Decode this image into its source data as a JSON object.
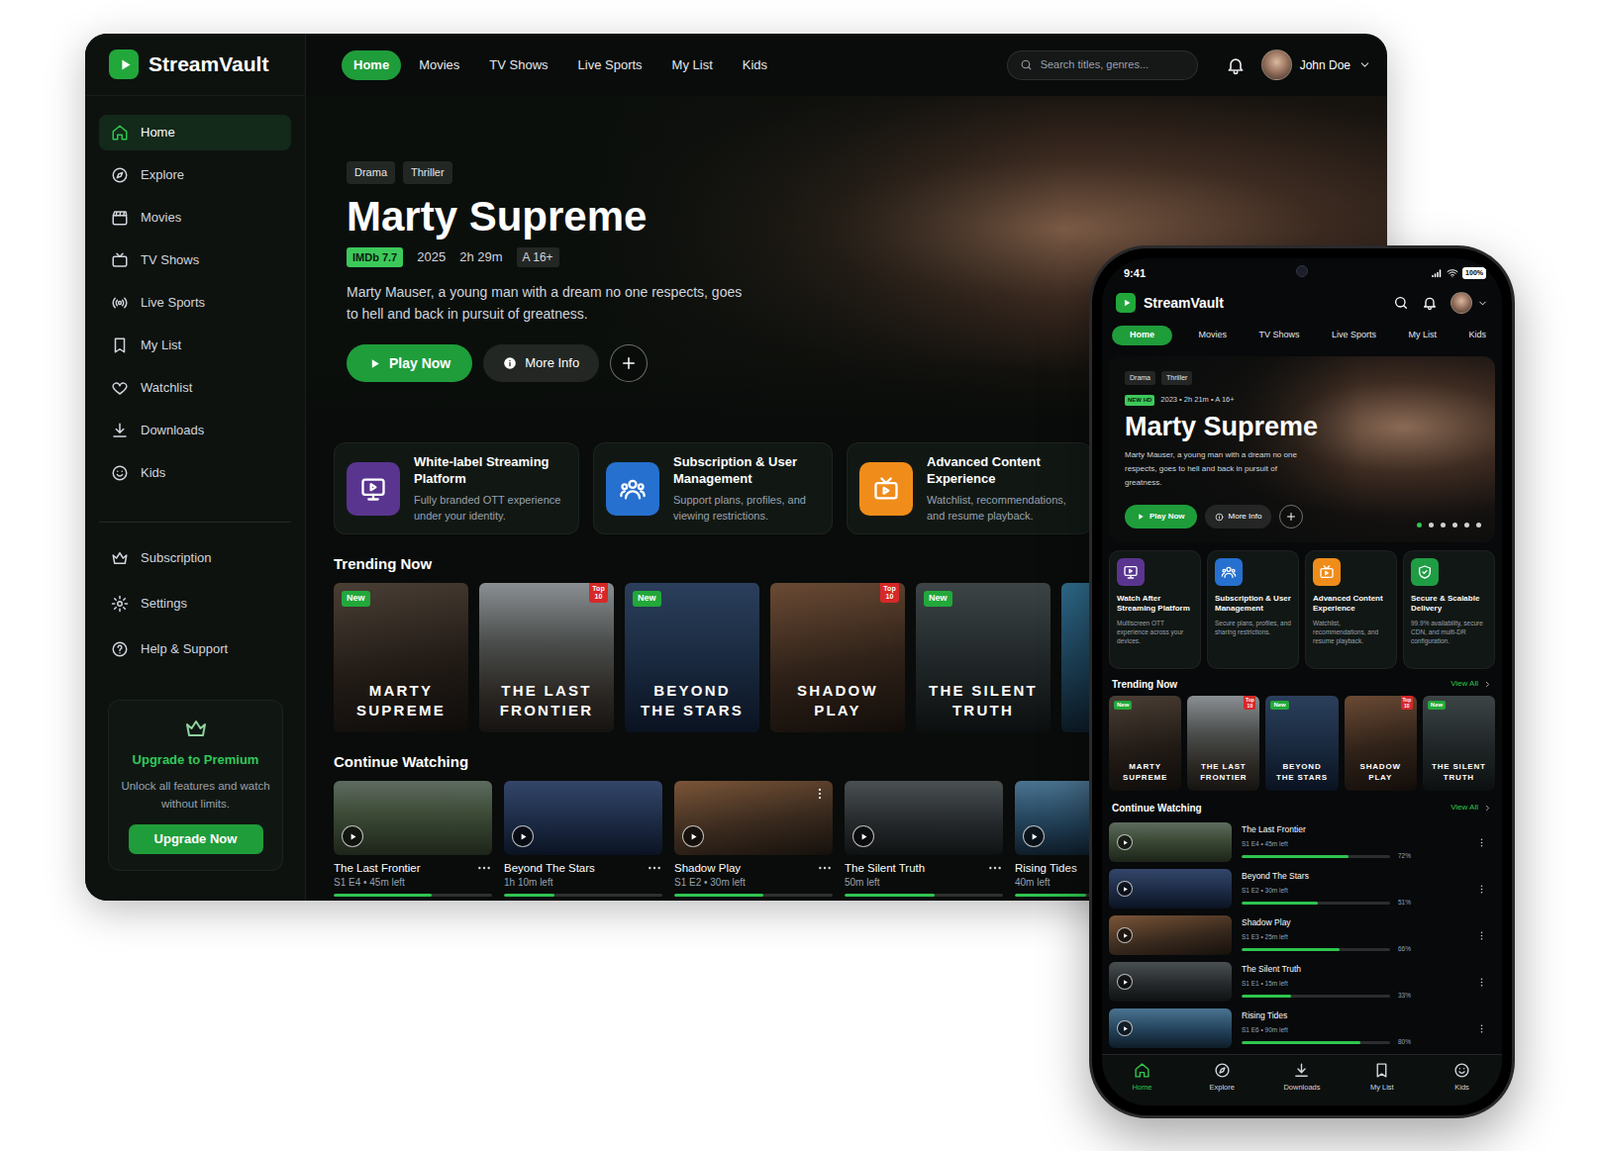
{
  "app": {
    "name": "StreamVault"
  },
  "desktop": {
    "nav": [
      {
        "label": "Home",
        "selected": true
      },
      {
        "label": "Movies",
        "selected": false
      },
      {
        "label": "TV Shows",
        "selected": false
      },
      {
        "label": "Live Sports",
        "selected": false
      },
      {
        "label": "My List",
        "selected": false
      },
      {
        "label": "Kids",
        "selected": false
      }
    ],
    "search": {
      "placeholder": "Search titles, genres..."
    },
    "user": {
      "name": "John Doe"
    },
    "sidebar": {
      "main": [
        {
          "label": "Home",
          "selected": true
        },
        {
          "label": "Explore",
          "selected": false
        },
        {
          "label": "Movies",
          "selected": false
        },
        {
          "label": "TV Shows",
          "selected": false
        },
        {
          "label": "Live Sports",
          "selected": false
        },
        {
          "label": "My List",
          "selected": false
        },
        {
          "label": "Watchlist",
          "selected": false
        },
        {
          "label": "Downloads",
          "selected": false
        },
        {
          "label": "Kids",
          "selected": false
        }
      ],
      "secondary": [
        {
          "label": "Subscription",
          "selected": false
        },
        {
          "label": "Settings",
          "selected": false
        },
        {
          "label": "Help & Support",
          "selected": false
        }
      ]
    },
    "upgrade": {
      "title": "Upgrade to Premium",
      "text": "Unlock all features and watch without limits.",
      "button": "Upgrade Now"
    },
    "hero": {
      "tags": [
        "Drama",
        "Thriller"
      ],
      "title": "Marty Supreme",
      "rating": "IMDb 7.7",
      "year": "2025",
      "duration": "2h 29m",
      "age": "A 16+",
      "description": "Marty Mauser, a young man with a dream no one respects, goes to hell and back in pursuit of greatness.",
      "play": "Play Now",
      "info": "More Info"
    },
    "features": [
      {
        "title": "White-label Streaming Platform",
        "text": "Fully branded OTT experience under your identity.",
        "color": "#5a3590"
      },
      {
        "title": "Subscription & User Management",
        "text": "Support plans, profiles, and viewing restrictions.",
        "color": "#2670d0"
      },
      {
        "title": "Advanced Content Experience",
        "text": "Watchlist, recommendations, and resume playback.",
        "color": "#f08c1a"
      }
    ],
    "trending": {
      "title": "Trending Now",
      "items": [
        {
          "lines": [
            "MARTY",
            "SUPREME"
          ],
          "badge": "New",
          "kind": "new"
        },
        {
          "lines": [
            "THE LAST",
            "FRONTIER"
          ],
          "badge": "Top 10",
          "kind": "top"
        },
        {
          "lines": [
            "BEYOND",
            "THE STARS"
          ],
          "badge": "New",
          "kind": "new"
        },
        {
          "lines": [
            "SHADOW",
            "PLAY"
          ],
          "badge": "Top 10",
          "kind": "top"
        },
        {
          "lines": [
            "THE SILENT",
            "TRUTH"
          ],
          "badge": "New",
          "kind": "new"
        },
        {
          "lines": [],
          "kind": "plain"
        }
      ]
    },
    "continue": {
      "title": "Continue Watching",
      "items": [
        {
          "title": "The Last Frontier",
          "meta": "S1 E4 • 45m left",
          "level": 0.62,
          "hovered": false
        },
        {
          "title": "Beyond The Stars",
          "meta": "1h 10m left",
          "level": 0.32,
          "hovered": false
        },
        {
          "title": "Shadow Play",
          "meta": "S1 E2 • 30m left",
          "level": 0.56,
          "hovered": true
        },
        {
          "title": "The Silent Truth",
          "meta": "50m left",
          "level": 0.57,
          "hovered": false
        },
        {
          "title": "Rising Tides",
          "meta": "40m left",
          "level": 0.45,
          "hovered": false
        }
      ]
    }
  },
  "phone": {
    "status": {
      "time": "9:41",
      "battery": "100%"
    },
    "nav": [
      {
        "label": "Home",
        "selected": true
      },
      {
        "label": "Movies",
        "selected": false
      },
      {
        "label": "TV Shows",
        "selected": false
      },
      {
        "label": "Live Sports",
        "selected": false
      },
      {
        "label": "My List",
        "selected": false
      },
      {
        "label": "Kids",
        "selected": false
      }
    ],
    "hero": {
      "tags": [
        "Drama",
        "Thriller"
      ],
      "badge": "NEW HD",
      "meta": "2023 • 2h 21m • A 16+",
      "title": "Marty Supreme",
      "description": "Marty Mauser, a young man with a dream no one respects, goes to hell and back in pursuit of greatness.",
      "play": "Play Now",
      "info": "More Info",
      "slides": [
        {
          "selected": true
        },
        {
          "selected": false
        },
        {
          "selected": false
        },
        {
          "selected": false
        },
        {
          "selected": false
        },
        {
          "selected": false
        }
      ]
    },
    "features": [
      {
        "title": "Watch After Streaming Platform",
        "text": "Multiscreen OTT experience across your devices.",
        "color": "#5a3590"
      },
      {
        "title": "Subscription & User Management",
        "text": "Secure plans, profiles, and sharing restrictions.",
        "color": "#2670d0"
      },
      {
        "title": "Advanced Content Experience",
        "text": "Watchlist, recommendations, and resume playback.",
        "color": "#f08c1a"
      },
      {
        "title": "Secure & Scalable Delivery",
        "text": "99.9% availability, secure CDN, and multi-DR configuration.",
        "color": "#1f9d44"
      }
    ],
    "trending": {
      "title": "Trending Now",
      "view_all": "View All",
      "items": [
        {
          "lines": [
            "MARTY",
            "SUPREME"
          ],
          "badge": "New",
          "kind": "new"
        },
        {
          "lines": [
            "THE LAST",
            "FRONTIER"
          ],
          "badge": "Top 10",
          "kind": "top"
        },
        {
          "lines": [
            "BEYOND",
            "THE STARS"
          ],
          "badge": "New",
          "kind": "new"
        },
        {
          "lines": [
            "SHADOW",
            "PLAY"
          ],
          "badge": "Top 10",
          "kind": "top"
        },
        {
          "lines": [
            "THE SILENT",
            "TRUTH"
          ],
          "badge": "New",
          "kind": "new"
        }
      ]
    },
    "continue": {
      "title": "Continue Watching",
      "view_all": "View All",
      "items": [
        {
          "title": "The Last Frontier",
          "meta": "S1 E4 • 45m left",
          "percent": "72%",
          "level": 0.72
        },
        {
          "title": "Beyond The Stars",
          "meta": "S1 E2 • 30m left",
          "percent": "51%",
          "level": 0.51
        },
        {
          "title": "Shadow Play",
          "meta": "S1 E3 • 25m left",
          "percent": "66%",
          "level": 0.66
        },
        {
          "title": "The Silent Truth",
          "meta": "S1 E1 • 15m left",
          "percent": "33%",
          "level": 0.33
        },
        {
          "title": "Rising Tides",
          "meta": "S1 E6 • 90m left",
          "percent": "80%",
          "level": 0.8
        }
      ]
    },
    "tabbar": [
      {
        "label": "Home",
        "selected": true
      },
      {
        "label": "Explore",
        "selected": false
      },
      {
        "label": "Downloads",
        "selected": false
      },
      {
        "label": "My List",
        "selected": false
      },
      {
        "label": "Kids",
        "selected": false
      }
    ]
  }
}
